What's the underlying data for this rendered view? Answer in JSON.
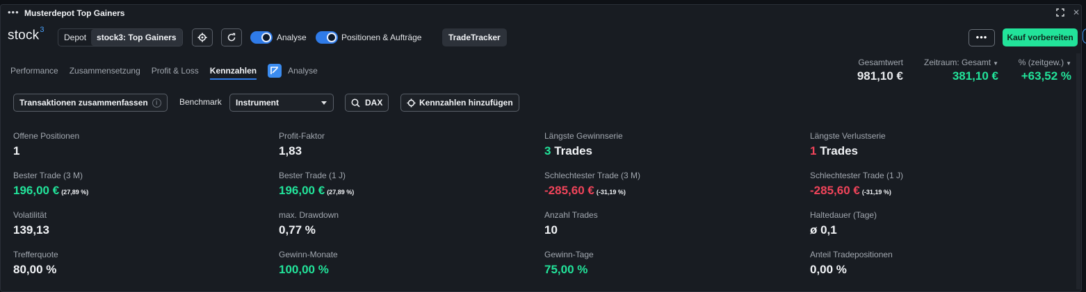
{
  "window": {
    "title": "Musterdepot Top Gainers"
  },
  "header": {
    "logo_text": "stock",
    "logo_sup": "3",
    "depot_label": "Depot",
    "depot_value": "stock3: Top Gainers",
    "toggle_analyse": "Analyse",
    "toggle_positions": "Positionen & Aufträge",
    "tradetracker": "TradeTracker",
    "more_label": "•••",
    "buy_label": "Kauf vorbereiten",
    "accent_color": "#22e39a",
    "toggle_color": "#2f7be8"
  },
  "tabs": [
    {
      "label": "Performance",
      "active": false
    },
    {
      "label": "Zusammensetzung",
      "active": false
    },
    {
      "label": "Profit & Loss",
      "active": false
    },
    {
      "label": "Kennzahlen",
      "active": true
    },
    {
      "label": "Analyse",
      "active": false
    }
  ],
  "summary": {
    "total_label": "Gesamtwert",
    "total_value": "981,10 €",
    "period_label": "Zeitraum: Gesamt",
    "period_value": "381,10 €",
    "pct_label": "% (zeitgew.)",
    "pct_value": "+63,52 %"
  },
  "toolbar": {
    "summarize_label": "Transaktionen zusammenfassen",
    "info_glyph": "i",
    "benchmark_label": "Benchmark",
    "benchmark_value": "Instrument",
    "dax_label": "DAX",
    "add_label": "Kennzahlen hinzufügen"
  },
  "metrics": [
    {
      "label": "Offene Positionen",
      "value": "1"
    },
    {
      "label": "Profit-Faktor",
      "value": "1,83"
    },
    {
      "label": "Längste Gewinnserie",
      "num": "3",
      "suffix": "Trades"
    },
    {
      "label": "Längste Verlustserie",
      "num": "1",
      "suffix": "Trades"
    },
    {
      "label": "Bester Trade (3 M)",
      "value": "196,00 €",
      "pct": "(27,89 %)"
    },
    {
      "label": "Bester Trade (1 J)",
      "value": "196,00 €",
      "pct": "(27,89 %)"
    },
    {
      "label": "Schlechtester Trade (3 M)",
      "value": "-285,60 €",
      "pct": "(-31,19 %)"
    },
    {
      "label": "Schlechtester Trade (1 J)",
      "value": "-285,60 €",
      "pct": "(-31,19 %)"
    },
    {
      "label": "Volatilität",
      "value": "139,13"
    },
    {
      "label": "max. Drawdown",
      "value": "0,77 %"
    },
    {
      "label": "Anzahl Trades",
      "value": "10"
    },
    {
      "label": "Haltedauer (Tage)",
      "value": "ø 0,1"
    },
    {
      "label": "Trefferquote",
      "value": "80,00 %"
    },
    {
      "label": "Gewinn-Monate",
      "value": "100,00 %"
    },
    {
      "label": "Gewinn-Tage",
      "value": "75,00 %"
    },
    {
      "label": "Anteil Tradepositionen",
      "value": "0,00 %"
    }
  ]
}
